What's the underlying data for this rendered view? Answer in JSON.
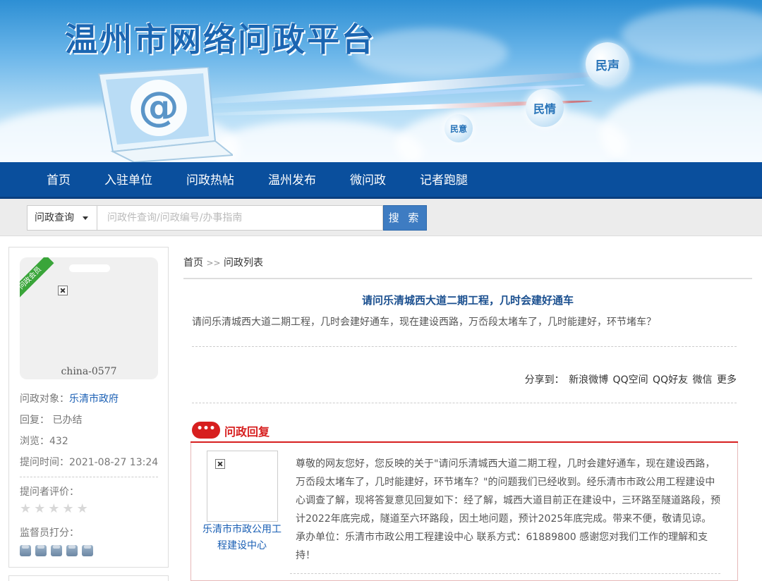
{
  "site": {
    "title": "温州市网络问政平台",
    "bubbles": [
      "民声",
      "民情",
      "民意"
    ]
  },
  "nav": [
    "首页",
    "入驻单位",
    "问政热帖",
    "温州发布",
    "微问政",
    "记者跑腿"
  ],
  "search": {
    "type_label": "问政查询",
    "placeholder": "问政件查询/问政编号/办事指南",
    "button": "搜 索"
  },
  "sidebar": {
    "ribbon": "问政会员",
    "username": "china-0577",
    "target_label": "问政对象：",
    "target_value": "乐清市政府",
    "reply_label": "回复：",
    "reply_value": "已办结",
    "views_label": "浏览：",
    "views_value": "432",
    "time_label": "提问时间：",
    "time_value": "2021-08-27 13:24",
    "asker_rating_label": "提问者评价：",
    "supervisor_label": "监督员打分："
  },
  "breadcrumb": {
    "home": "首页",
    "sep": ">>",
    "current": "问政列表"
  },
  "post": {
    "title": "请问乐清城西大道二期工程，几时会建好通车",
    "body": "请问乐清城西大道二期工程，几时会建好通车，现在建设西路，万岙段太堵车了，几时能建好，环节堵车？"
  },
  "share": {
    "label": "分享到：",
    "targets": [
      "新浪微博",
      "QQ空间",
      "QQ好友",
      "微信",
      "更多"
    ]
  },
  "reply": {
    "icon": "•••",
    "title": "问政回复",
    "org": "乐清市市政公用工程建设中心",
    "text": "尊敬的网友您好，您反映的关于\"请问乐清城西大道二期工程，几时会建好通车，现在建设西路，万岙段太堵车了，几时能建好，环节堵车？\"的问题我们已经收到。经乐清市市政公用工程建设中心调查了解，现将答复意见回复如下：经了解，城西大道目前正在建设中，三环路至隧道路段，预计2022年底完成，隧道至六环路段，因土地问题，预计2025年底完成。带来不便，敬请见谅。 承办单位：乐清市市政公用工程建设中心 联系方式：61889800 感谢您对我们工作的理解和支持！"
  },
  "ratings": {
    "asker_stars": 5,
    "supervisor_badges": 5
  }
}
